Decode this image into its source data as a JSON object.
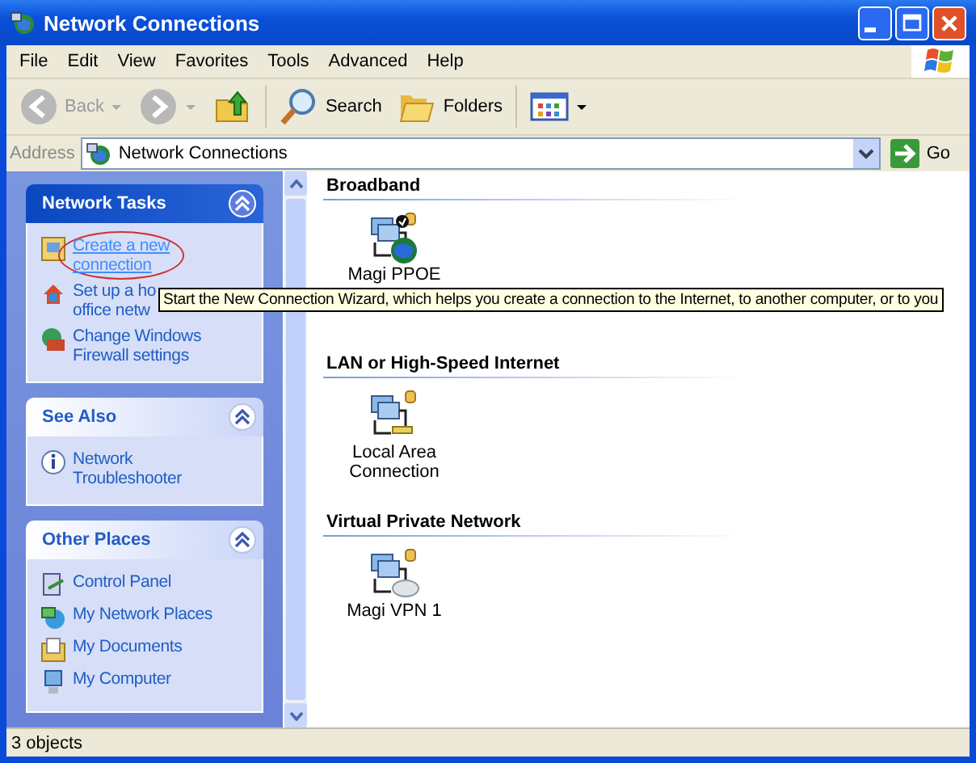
{
  "window": {
    "title": "Network Connections"
  },
  "menu": [
    {
      "label": "File"
    },
    {
      "label": "Edit"
    },
    {
      "label": "View"
    },
    {
      "label": "Favorites"
    },
    {
      "label": "Tools"
    },
    {
      "label": "Advanced"
    },
    {
      "label": "Help"
    }
  ],
  "toolbar": [
    {
      "kind": "back",
      "label": "Back",
      "disabled": true
    },
    {
      "kind": "forward",
      "disabled": true
    },
    {
      "kind": "up",
      "disabled": false
    },
    {
      "kind": "search",
      "label": "Search",
      "disabled": false
    },
    {
      "kind": "folders",
      "label": "Folders",
      "disabled": false
    },
    {
      "kind": "views",
      "disabled": false
    }
  ],
  "address": {
    "label": "Address",
    "value": "Network Connections",
    "go": "Go"
  },
  "panels": [
    {
      "title": "Network Tasks",
      "kind": "special",
      "items": [
        {
          "kind": "wizard",
          "lines": [
            "Create a new",
            "connection"
          ],
          "hover": true,
          "circled": true
        },
        {
          "kind": "home",
          "lines": [
            "Set up a ho",
            "office netw"
          ],
          "hover": false,
          "circled": false
        },
        {
          "kind": "firewall",
          "lines": [
            "Change Windows",
            "Firewall settings"
          ],
          "hover": false,
          "circled": false
        }
      ]
    },
    {
      "title": "See Also",
      "kind": "normal",
      "items": [
        {
          "kind": "info",
          "lines": [
            "Network",
            "Troubleshooter"
          ],
          "hover": false,
          "circled": false
        }
      ]
    },
    {
      "title": "Other Places",
      "kind": "normal",
      "items": [
        {
          "kind": "control",
          "lines": [
            "Control Panel"
          ],
          "hover": false,
          "circled": false
        },
        {
          "kind": "netplaces",
          "lines": [
            "My Network Places"
          ],
          "hover": false,
          "circled": false
        },
        {
          "kind": "docs",
          "lines": [
            "My Documents"
          ],
          "hover": false,
          "circled": false
        },
        {
          "kind": "computer",
          "lines": [
            "My Computer"
          ],
          "hover": false,
          "circled": false
        }
      ]
    }
  ],
  "groups": [
    {
      "title": "Broadband",
      "items": [
        {
          "kind": "broadband",
          "lines": [
            "Magi PPOE"
          ]
        }
      ]
    },
    {
      "title": "LAN or High-Speed Internet",
      "items": [
        {
          "kind": "lan",
          "lines": [
            "Local Area",
            "Connection"
          ]
        }
      ]
    },
    {
      "title": "Virtual Private Network",
      "items": [
        {
          "kind": "vpn",
          "lines": [
            "Magi VPN 1"
          ]
        }
      ]
    }
  ],
  "tooltip": "Start the New Connection Wizard, which helps you create a connection to the Internet, to another computer, or to you",
  "status_bar": "3 objects"
}
